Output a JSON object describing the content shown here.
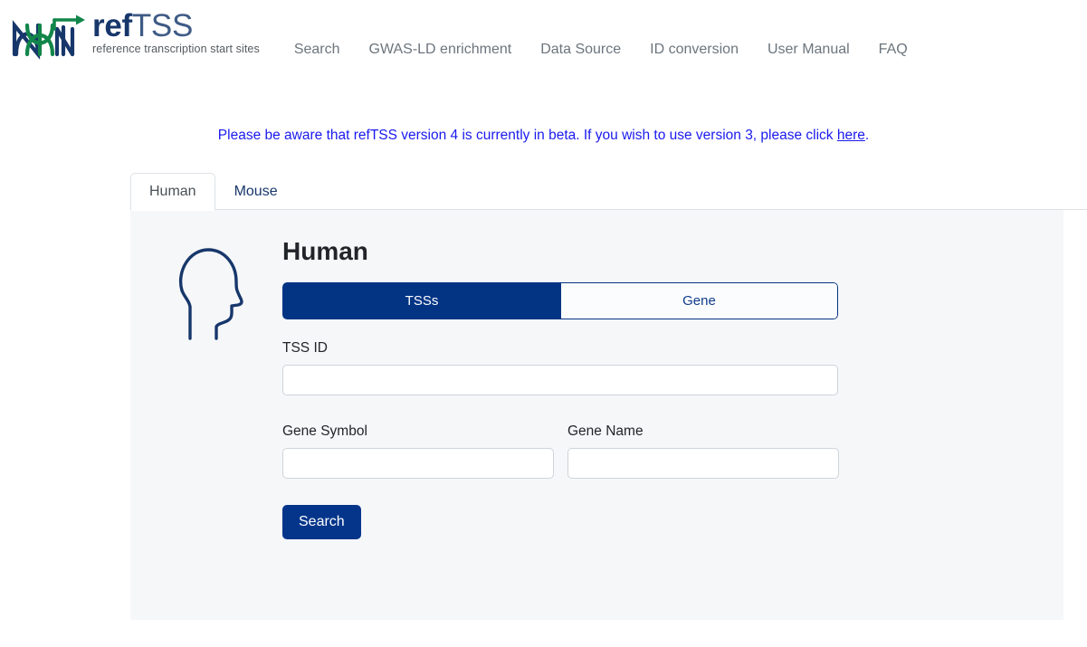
{
  "brand": {
    "logo_icon": "dna-helix-arrow-logo",
    "wordmark_bold": "ref",
    "wordmark_light": "TSS",
    "tagline": "reference transcription start sites"
  },
  "nav": {
    "items": [
      {
        "label": "Search"
      },
      {
        "label": "GWAS-LD enrichment"
      },
      {
        "label": "Data Source"
      },
      {
        "label": "ID conversion"
      },
      {
        "label": "User Manual"
      },
      {
        "label": "FAQ"
      }
    ]
  },
  "beta_notice": {
    "text_before": "Please be aware that refTSS version 4 is currently in beta. If you wish to use version 3, please click ",
    "link_label": "here",
    "text_after": "."
  },
  "species_tabs": [
    {
      "label": "Human",
      "active": true
    },
    {
      "label": "Mouse",
      "active": false
    }
  ],
  "panel": {
    "icon": "human-head-profile-icon",
    "title": "Human",
    "mode_toggle": [
      {
        "label": "TSSs",
        "active": true
      },
      {
        "label": "Gene",
        "active": false
      }
    ],
    "fields": {
      "tss_id": {
        "label": "TSS ID",
        "value": "",
        "placeholder": ""
      },
      "gene_symbol": {
        "label": "Gene Symbol",
        "value": "",
        "placeholder": ""
      },
      "gene_name": {
        "label": "Gene Name",
        "value": "",
        "placeholder": ""
      }
    },
    "submit_label": "Search"
  },
  "colors": {
    "navy": "#033484",
    "navy_button": "#05358a",
    "logo_green": "#12864a",
    "logo_navy": "#17376b",
    "link_blue": "#1a1aee",
    "panel_bg": "#f6f7f9",
    "nav_gray": "#6c757d",
    "input_border": "#ced4da"
  }
}
